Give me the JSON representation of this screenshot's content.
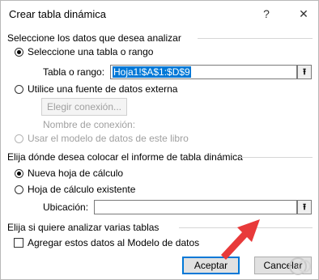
{
  "dialog": {
    "title": "Crear tabla dinámica",
    "help_glyph": "?",
    "close_glyph": "✕"
  },
  "select_data": {
    "heading": "Seleccione los datos que desea analizar",
    "option_table": "Seleccione una tabla o rango",
    "range_label": "Tabla o rango:",
    "range_value": "Hoja1!$A$1:$D$9",
    "option_external": "Utilice una fuente de datos externa",
    "choose_connection_button": "Elegir conexión...",
    "connection_name_label": "Nombre de conexión:",
    "option_data_model": "Usar el modelo de datos de este libro"
  },
  "placement": {
    "heading": "Elija dónde desea colocar el informe de tabla dinámica",
    "option_new_sheet": "Nueva hoja de cálculo",
    "option_existing_sheet": "Hoja de cálculo existente",
    "location_label": "Ubicación:",
    "location_value": ""
  },
  "multiple_tables": {
    "heading": "Elija si quiere analizar varias tablas",
    "add_to_model_label": "Agregar estos datos al Modelo de datos"
  },
  "footer": {
    "accept_button": "Aceptar",
    "cancel_button": "Cancelar"
  },
  "icons": {
    "collapse_dialog": "range-collapse-icon",
    "annotation": "red-arrow-icon",
    "watermark": "watermark-logo-icon"
  },
  "colors": {
    "accent": "#0078d7",
    "arrow": "#e83a3a"
  }
}
